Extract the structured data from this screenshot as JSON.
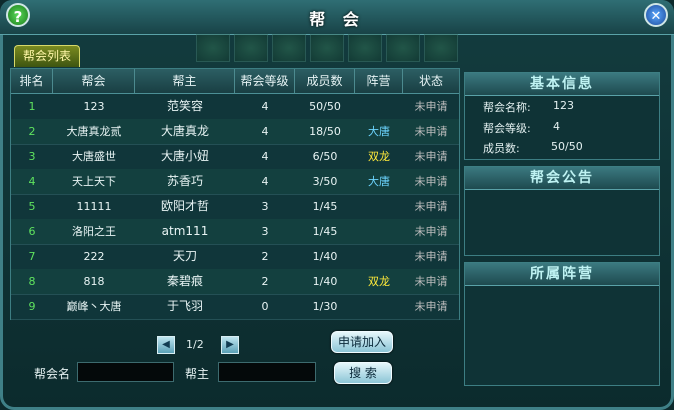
{
  "window": {
    "title": "帮 会"
  },
  "tab": {
    "label": "帮会列表"
  },
  "table": {
    "headers": [
      "排名",
      "帮会",
      "帮主",
      "帮会等级",
      "成员数",
      "阵营",
      "状态"
    ],
    "rows": [
      [
        "1",
        "123",
        "范笑容",
        "4",
        "50/50",
        "",
        "未申请"
      ],
      [
        "2",
        "大唐真龙贰",
        "大唐真龙",
        "4",
        "18/50",
        "大唐",
        "未申请"
      ],
      [
        "3",
        "大唐盛世",
        "大唐小妞",
        "4",
        "6/50",
        "双龙",
        "未申请"
      ],
      [
        "4",
        "天上天下",
        "苏香巧",
        "4",
        "3/50",
        "大唐",
        "未申请"
      ],
      [
        "5",
        "11111",
        "欧阳才哲",
        "3",
        "1/45",
        "",
        "未申请"
      ],
      [
        "6",
        "洛阳之王",
        "atm111",
        "3",
        "1/45",
        "",
        "未申请"
      ],
      [
        "7",
        "222",
        "天刀",
        "2",
        "1/40",
        "",
        "未申请"
      ],
      [
        "8",
        "818",
        "秦碧痕",
        "2",
        "1/40",
        "双龙",
        "未申请"
      ],
      [
        "9",
        "巅峰丶大唐",
        "于飞羽",
        "0",
        "1/30",
        "",
        "未申请"
      ]
    ],
    "camp_colors": {
      "大唐": "#6dd5ff",
      "双龙": "#ffea3a"
    }
  },
  "pager": {
    "text": "1/2"
  },
  "search": {
    "guild_label": "帮会名",
    "guild_value": "",
    "master_label": "帮主",
    "master_value": "",
    "apply_button": "申请加入",
    "search_button": "搜 索"
  },
  "basic_info": {
    "title": "基本信息",
    "name_label": "帮会名称:",
    "name_value": "123",
    "level_label": "帮会等级:",
    "level_value": "4",
    "members_label": "成员数:",
    "members_value": "50/50"
  },
  "announcement": {
    "title": "帮会公告"
  },
  "faction": {
    "title": "所属阵营"
  }
}
